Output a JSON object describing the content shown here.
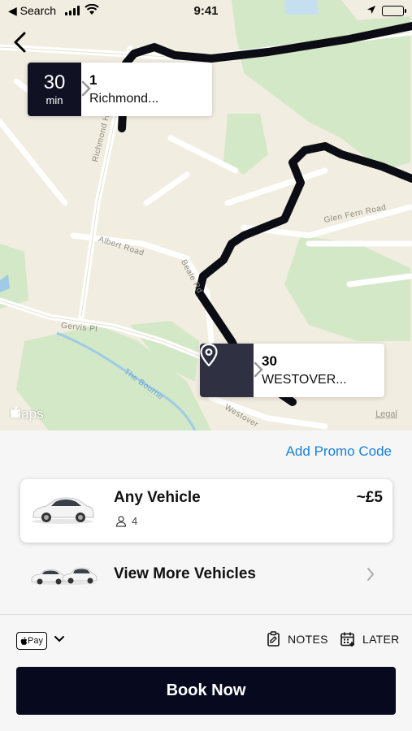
{
  "status_bar": {
    "back_app": "◀ Search",
    "time": "9:41"
  },
  "map": {
    "labels": {
      "richmond_hill": "Richmond Hill",
      "albert_road": "Albert Road",
      "beale_rd": "Beale Rd",
      "glen_fern_road": "Glen Fern Road",
      "gervis_pl": "Gervis Pl",
      "the_bourne": "The Bourne",
      "westover": "Westover"
    },
    "pickup_card": {
      "eta_value": "30",
      "eta_unit": "min",
      "line1": "1",
      "line2": "Richmond..."
    },
    "dropoff_card": {
      "icon": "location-pin-icon",
      "line1": "30",
      "line2": "WESTOVER..."
    },
    "attribution": "Maps",
    "legal": "Legal",
    "colors": {
      "land": "#f1ede0",
      "park": "#d3e8c6",
      "water": "#9fcbe6",
      "route": "#0c0d14"
    }
  },
  "sheet": {
    "promo_link": "Add Promo Code",
    "vehicle": {
      "name": "Any Vehicle",
      "seats": "4",
      "price": "~£5"
    },
    "view_more": "View More Vehicles",
    "payment": {
      "apple_pay_label": "Pay"
    },
    "notes_label": "NOTES",
    "later_label": "LATER",
    "book_button": "Book Now",
    "colors": {
      "accent_link": "#1a7fd9",
      "primary_button": "#070a1f"
    }
  }
}
